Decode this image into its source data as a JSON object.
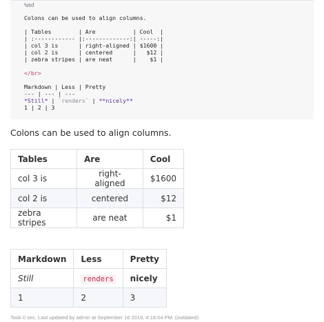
{
  "source": {
    "header": "%md",
    "line_intro": "Colons can be used to align columns.",
    "table_head": "| Tables        | Are           | Cool  |",
    "table_sep": "| :------------ |:-------------:| -----:|",
    "table_row1": "| col 3 is      | right-aligned | $1600 |",
    "table_row2": "| col 2 is      | centered      |   $12 |",
    "table_row3": "| zebra stripes | are neat      |    $1 |",
    "br_tag": "</br>",
    "md_head": "Markdown | Less | Pretty",
    "md_sep": "--- | --- | ---",
    "md_row_still": "*Still*",
    "md_row_sep1": " | ",
    "md_row_renders": "`renders`",
    "md_row_sep2": " | ",
    "md_row_nicely": "**nicely**",
    "md_row2": "1 | 2 | 3"
  },
  "output": {
    "paragraph": "Colons can be used to align columns.",
    "table1": {
      "headers": [
        "Tables",
        "Are",
        "Cool"
      ],
      "rows": [
        [
          "col 3 is",
          "right-aligned",
          "$1600"
        ],
        [
          "col 2 is",
          "centered",
          "$12"
        ],
        [
          "zebra stripes",
          "are neat",
          "$1"
        ]
      ]
    },
    "table2": {
      "headers": [
        "Markdown",
        "Less",
        "Pretty"
      ],
      "rows": [
        [
          "Still",
          "renders",
          "nicely"
        ],
        [
          "1",
          "2",
          "3"
        ]
      ]
    }
  },
  "footer": "Took 0 sec. Last updated by admin at September 16 2019, 4:18:54 PM. (outdated)"
}
